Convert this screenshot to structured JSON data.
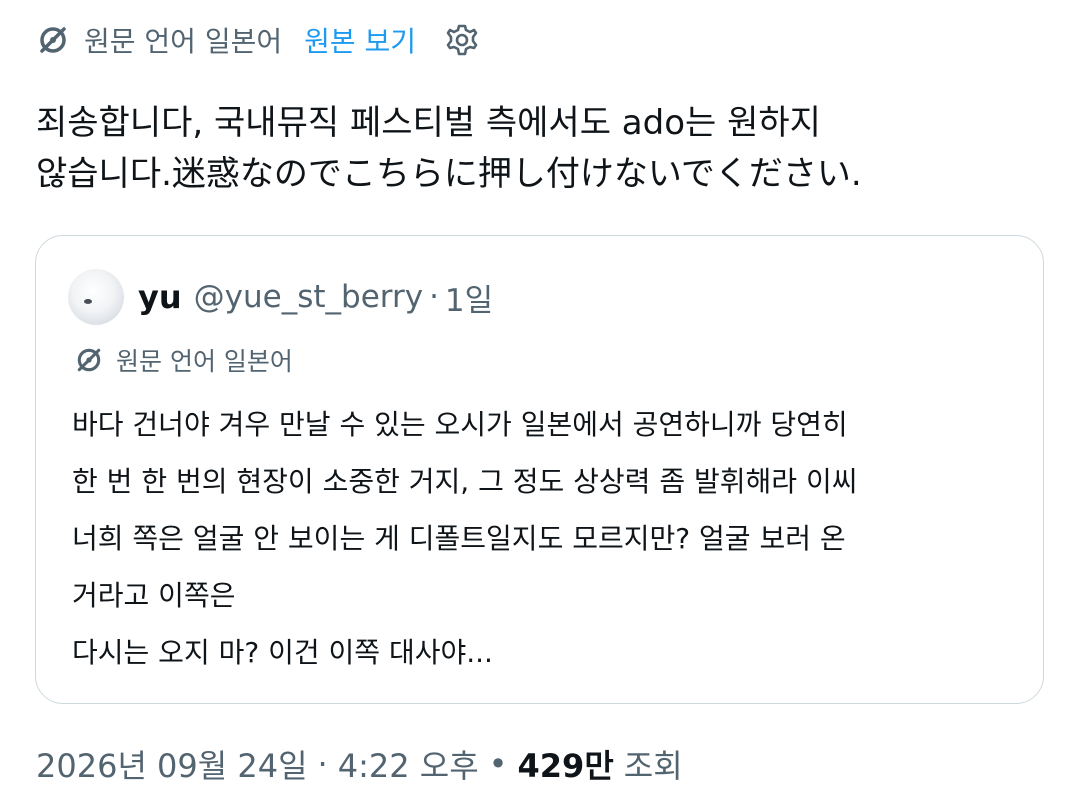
{
  "translation_bar": {
    "icon": "translate-icon",
    "label": "원문 언어 일본어",
    "show_original_label": "원본 보기",
    "settings_icon": "gear-icon"
  },
  "tweet": {
    "text_lines": [
      "죄송합니다, 국내뮤직 페스티벌 측에서도 ado는 원하지",
      "않습니다.迷惑なのでこちらに押し付けないでください."
    ]
  },
  "quote": {
    "avatar": "avatar",
    "display_name": "yu",
    "handle": "@yue_st_berry",
    "dot": "·",
    "time": "1일",
    "translate_label": "원문 언어 일본어",
    "text_lines": [
      "바다 건너야 겨우 만날 수 있는 오시가 일본에서 공연하니까 당연히",
      "한 번 한 번의 현장이 소중한 거지, 그 정도 상상력 좀 발휘해라 이씨",
      "너희 쪽은 얼굴 안 보이는 게 디폴트일지도 모르지만? 얼굴 보러 온",
      "거라고 이쪽은",
      "다시는 오지 마? 이건 이쪽 대사야..."
    ]
  },
  "meta": {
    "date": "2026년 09월 24일",
    "sep1": "·",
    "time": "4:22 오후",
    "sep2": "•",
    "views_count": "429만",
    "views_label": "조회"
  },
  "colors": {
    "text": "#0f1419",
    "secondary": "#536471",
    "link": "#1d9bf0",
    "border": "#cfd9de"
  }
}
